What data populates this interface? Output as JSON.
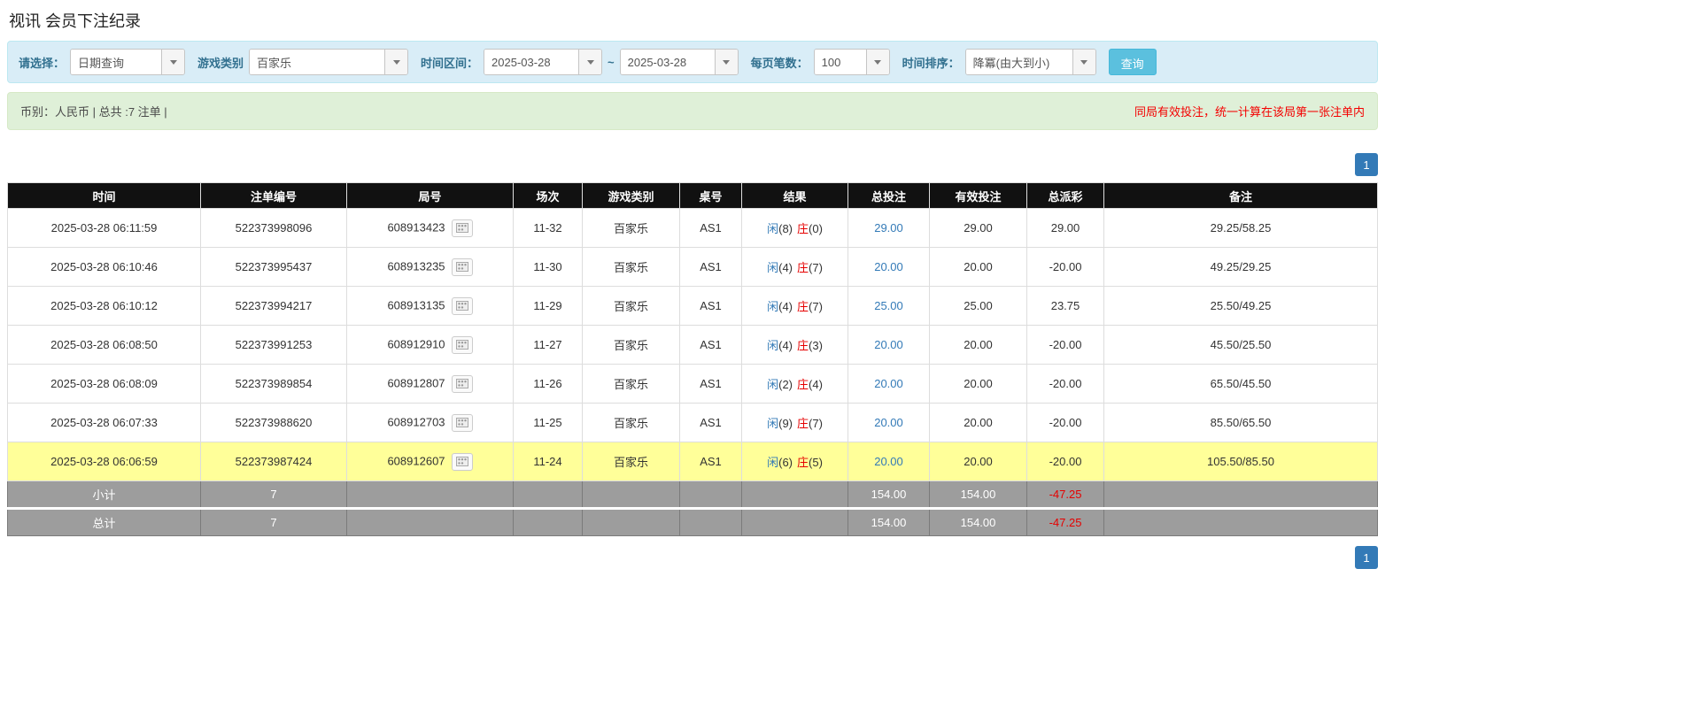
{
  "page": {
    "title": "视讯 会员下注纪录"
  },
  "filters": {
    "select_label": "请选择：",
    "select_value": "日期查询",
    "game_type_label": "游戏类别",
    "game_type_value": "百家乐",
    "time_range_label": "时间区间：",
    "date_from": "2025-03-28",
    "date_separator": "~",
    "date_to": "2025-03-28",
    "page_size_label": "每页笔数：",
    "page_size_value": "100",
    "sort_label": "时间排序：",
    "sort_value": "降冪(由大到小)",
    "search_button": "查询"
  },
  "summary": {
    "left": "币别：人民币 | 总共 :7 注单 |",
    "right": "同局有效投注，统一计算在该局第一张注单内"
  },
  "pagination": {
    "page": "1"
  },
  "colors": {
    "accent_blue": "#337ab7",
    "banker_red": "#e60000",
    "highlight_yellow": "#ffff99",
    "header_black": "#111111",
    "footer_gray": "#9d9d9d"
  },
  "table": {
    "headers": [
      "时间",
      "注单编号",
      "局号",
      "场次",
      "游戏类别",
      "桌号",
      "结果",
      "总投注",
      "有效投注",
      "总派彩",
      "备注"
    ],
    "rows": [
      {
        "time": "2025-03-28 06:11:59",
        "bet_id": "522373998096",
        "round_id": "608913423",
        "session": "11-32",
        "game": "百家乐",
        "table_no": "AS1",
        "res_p": "闲",
        "res_pn": "(8)",
        "res_b": "庄",
        "res_bn": "(0)",
        "total_bet": "29.00",
        "valid_bet": "29.00",
        "payout": "29.00",
        "remark": "29.25/58.25",
        "highlight": false
      },
      {
        "time": "2025-03-28 06:10:46",
        "bet_id": "522373995437",
        "round_id": "608913235",
        "session": "11-30",
        "game": "百家乐",
        "table_no": "AS1",
        "res_p": "闲",
        "res_pn": "(4)",
        "res_b": "庄",
        "res_bn": "(7)",
        "total_bet": "20.00",
        "valid_bet": "20.00",
        "payout": "-20.00",
        "remark": "49.25/29.25",
        "highlight": false
      },
      {
        "time": "2025-03-28 06:10:12",
        "bet_id": "522373994217",
        "round_id": "608913135",
        "session": "11-29",
        "game": "百家乐",
        "table_no": "AS1",
        "res_p": "闲",
        "res_pn": "(4)",
        "res_b": "庄",
        "res_bn": "(7)",
        "total_bet": "25.00",
        "valid_bet": "25.00",
        "payout": "23.75",
        "remark": "25.50/49.25",
        "highlight": false
      },
      {
        "time": "2025-03-28 06:08:50",
        "bet_id": "522373991253",
        "round_id": "608912910",
        "session": "11-27",
        "game": "百家乐",
        "table_no": "AS1",
        "res_p": "闲",
        "res_pn": "(4)",
        "res_b": "庄",
        "res_bn": "(3)",
        "total_bet": "20.00",
        "valid_bet": "20.00",
        "payout": "-20.00",
        "remark": "45.50/25.50",
        "highlight": false
      },
      {
        "time": "2025-03-28 06:08:09",
        "bet_id": "522373989854",
        "round_id": "608912807",
        "session": "11-26",
        "game": "百家乐",
        "table_no": "AS1",
        "res_p": "闲",
        "res_pn": "(2)",
        "res_b": "庄",
        "res_bn": "(4)",
        "total_bet": "20.00",
        "valid_bet": "20.00",
        "payout": "-20.00",
        "remark": "65.50/45.50",
        "highlight": false
      },
      {
        "time": "2025-03-28 06:07:33",
        "bet_id": "522373988620",
        "round_id": "608912703",
        "session": "11-25",
        "game": "百家乐",
        "table_no": "AS1",
        "res_p": "闲",
        "res_pn": "(9)",
        "res_b": "庄",
        "res_bn": "(7)",
        "total_bet": "20.00",
        "valid_bet": "20.00",
        "payout": "-20.00",
        "remark": "85.50/65.50",
        "highlight": false
      },
      {
        "time": "2025-03-28 06:06:59",
        "bet_id": "522373987424",
        "round_id": "608912607",
        "session": "11-24",
        "game": "百家乐",
        "table_no": "AS1",
        "res_p": "闲",
        "res_pn": "(6)",
        "res_b": "庄",
        "res_bn": "(5)",
        "total_bet": "20.00",
        "valid_bet": "20.00",
        "payout": "-20.00",
        "remark": "105.50/85.50",
        "highlight": true
      }
    ],
    "footer": [
      {
        "label": "小计",
        "count": "7",
        "total_bet": "154.00",
        "valid_bet": "154.00",
        "payout": "-47.25"
      },
      {
        "label": "总计",
        "count": "7",
        "total_bet": "154.00",
        "valid_bet": "154.00",
        "payout": "-47.25"
      }
    ]
  }
}
